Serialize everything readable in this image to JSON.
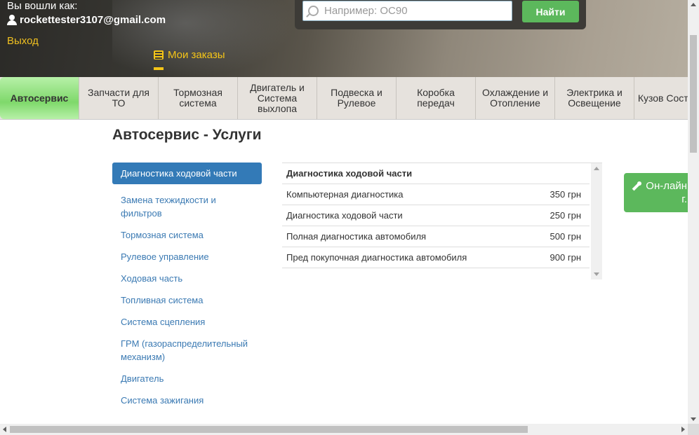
{
  "header": {
    "login_label": "Вы вошли как:",
    "user_email": "rockettester3107@gmail.com",
    "logout": "Выход",
    "orders": "Мои заказы"
  },
  "search": {
    "placeholder": "Например: OC90",
    "button": "Найти"
  },
  "nav": {
    "items": [
      {
        "label": "Автосервис",
        "active": true
      },
      {
        "label": "Запчасти для ТО"
      },
      {
        "label": "Тормозная система"
      },
      {
        "label": "Двигатель и Система выхлопа"
      },
      {
        "label": "Подвеска и Рулевое"
      },
      {
        "label": "Коробка передач"
      },
      {
        "label": "Охлаждение и Отопление"
      },
      {
        "label": "Электрика и Освещение"
      },
      {
        "label": "Кузов Составля"
      }
    ]
  },
  "page": {
    "title": "Автосервис - Услуги"
  },
  "side_menu": [
    "Диагностика ходовой части",
    "Замена техжидкости и фильтров",
    "Тормозная система",
    "Рулевое управление",
    "Ходовая часть",
    "Топливная система",
    "Система сцепления",
    "ГРМ (газораспределительный механизм)",
    "Двигатель",
    "Система зажигания"
  ],
  "services_table": {
    "header": "Диагностика ходовой части",
    "rows": [
      {
        "name": "Компьютерная диагностика",
        "price": "350 грн"
      },
      {
        "name": "Диагностика ходовой части",
        "price": "250 грн"
      },
      {
        "name": "Полная диагностика автомобиля",
        "price": "500 грн"
      },
      {
        "name": "Пред покупочная диагностика автомобиля",
        "price": "900 грн"
      }
    ]
  },
  "online_button": {
    "line1": "Он-лайн",
    "line2": "г."
  },
  "colors": {
    "accent_green": "#5cb85c",
    "active_blue": "#337ab7",
    "link_blue": "#3b7ab3",
    "orders_yellow": "#f5c518"
  }
}
